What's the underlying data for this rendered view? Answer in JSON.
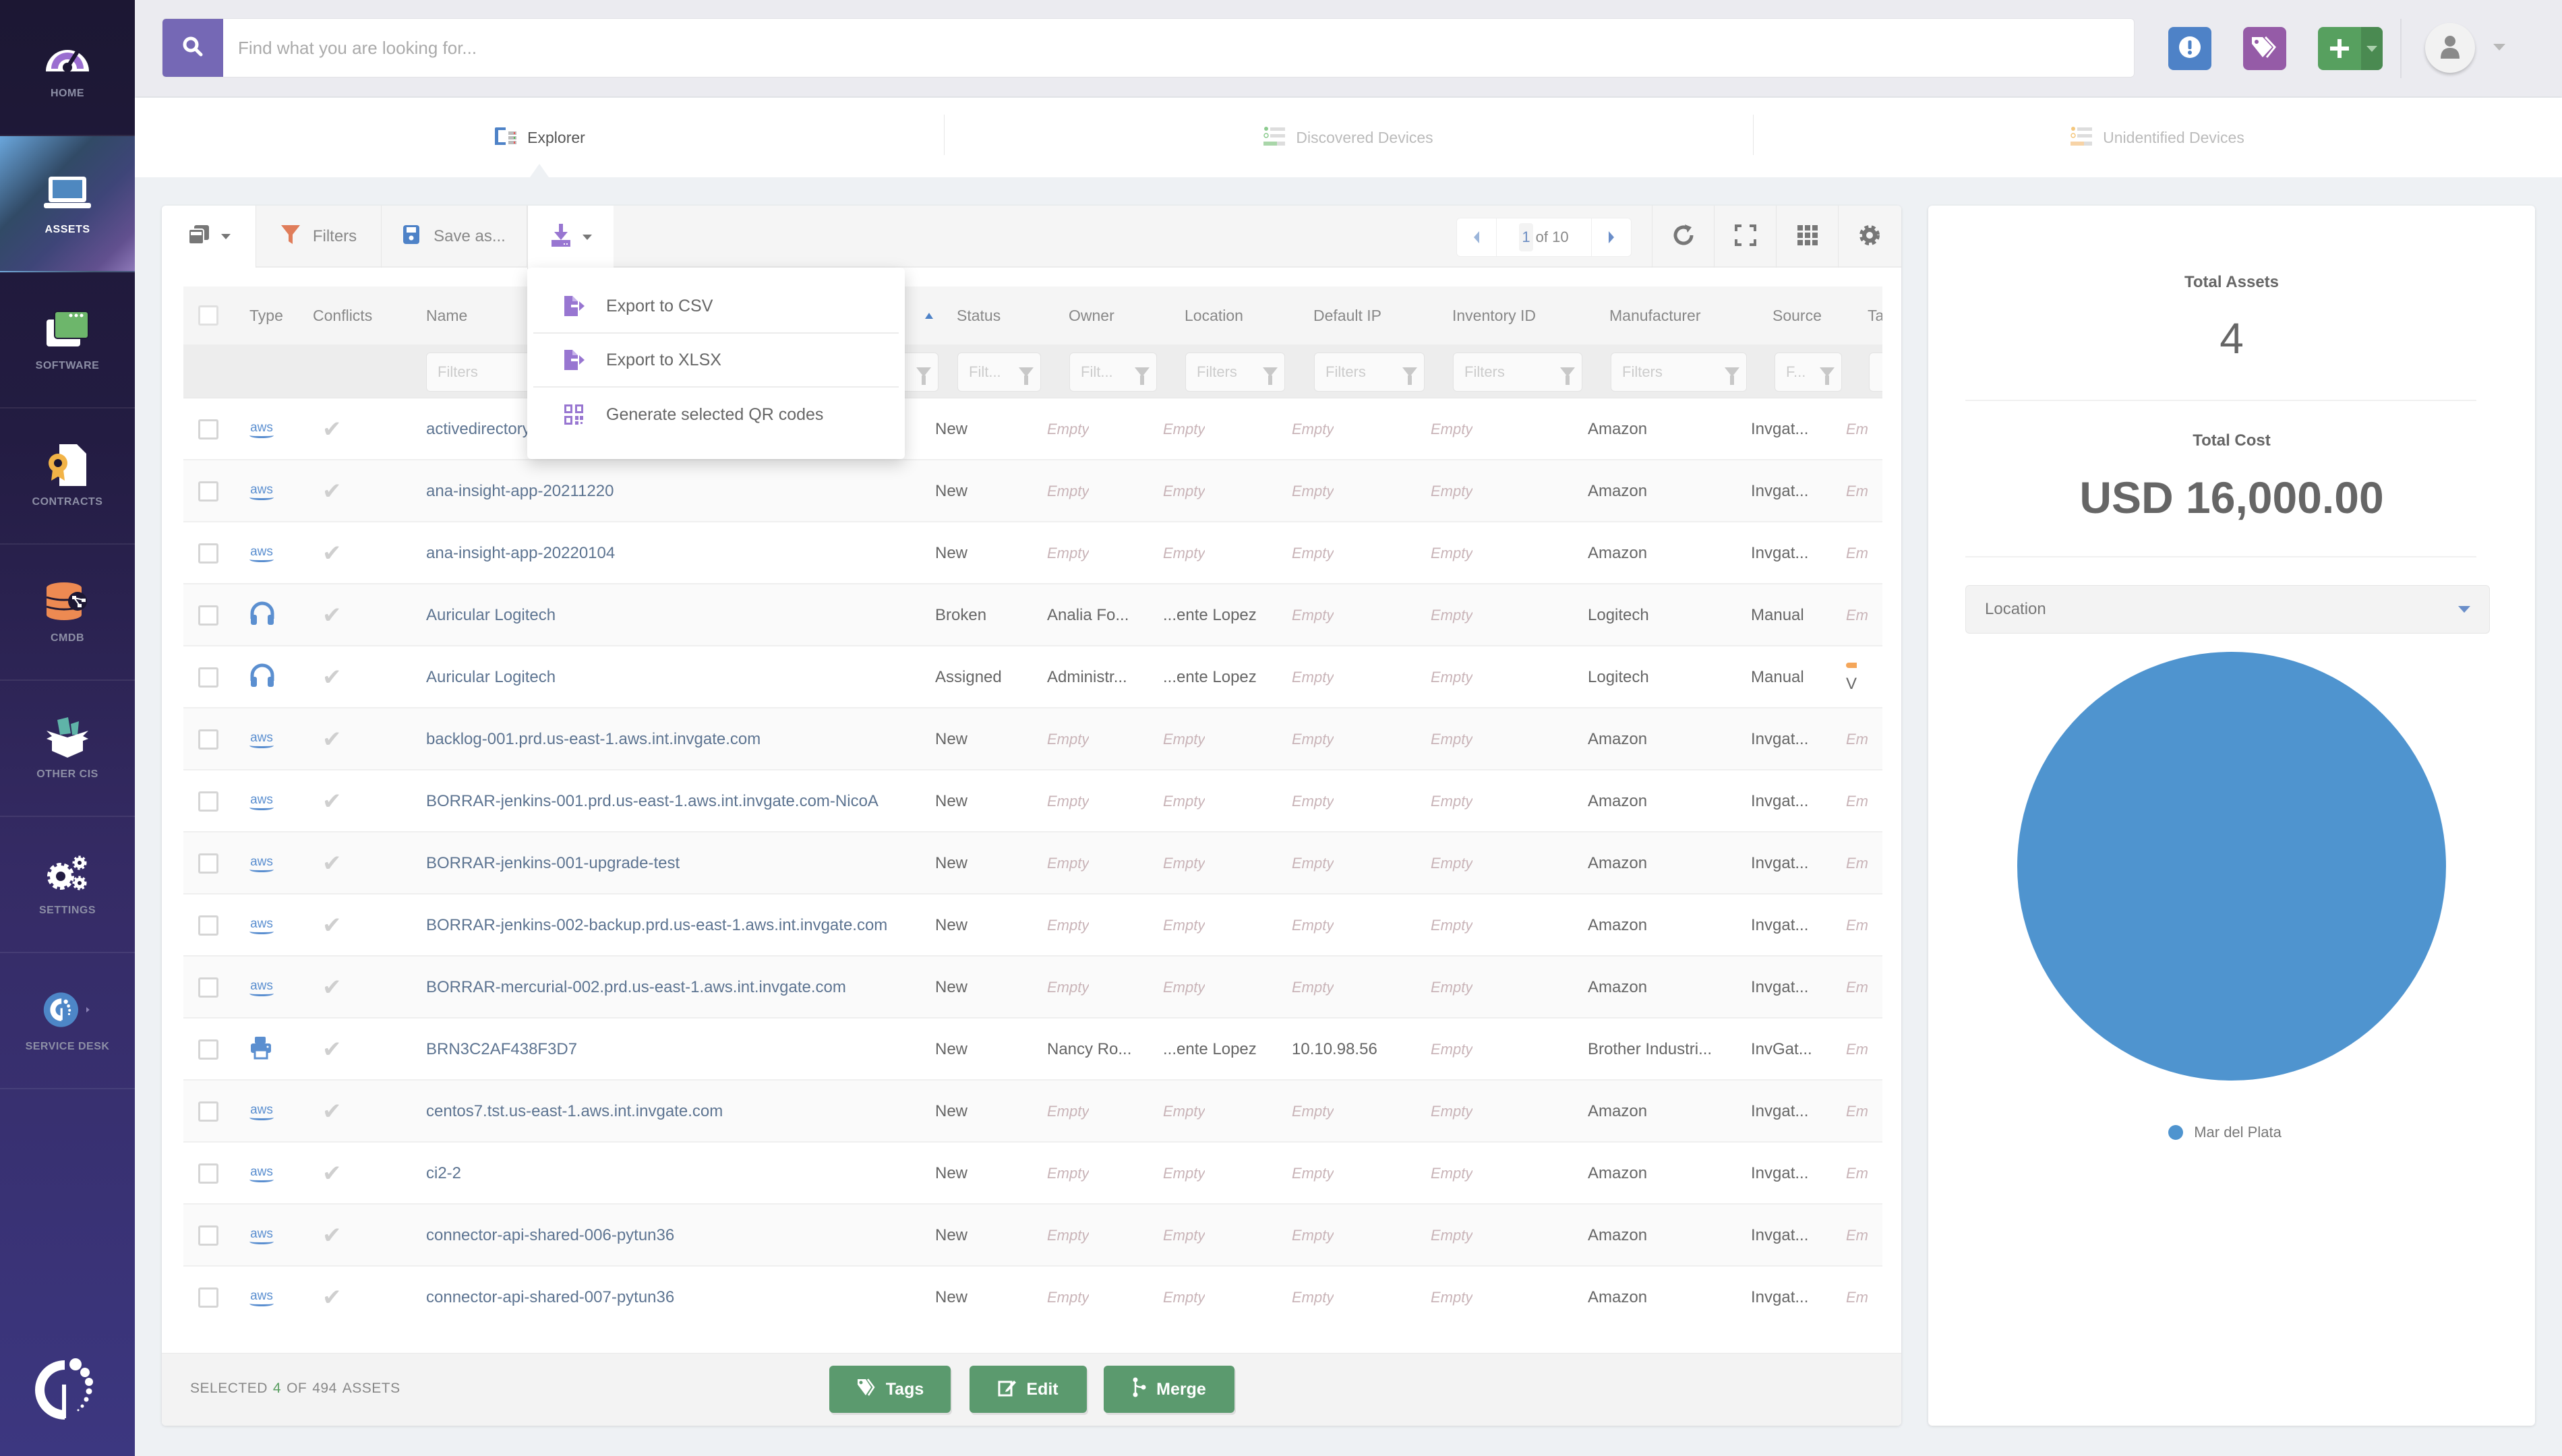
{
  "sidebar": {
    "items": [
      {
        "label": "HOME",
        "icon": "speedometer-icon"
      },
      {
        "label": "ASSETS",
        "icon": "laptop-icon",
        "active": true
      },
      {
        "label": "SOFTWARE",
        "icon": "software-window-icon"
      },
      {
        "label": "CONTRACTS",
        "icon": "contract-icon"
      },
      {
        "label": "CMDB",
        "icon": "database-icon"
      },
      {
        "label": "OTHER CIs",
        "icon": "box-icon"
      },
      {
        "label": "SETTINGS",
        "icon": "gears-icon"
      },
      {
        "label": "SERVICE DESK",
        "icon": "service-desk-icon"
      }
    ]
  },
  "search": {
    "placeholder": "Find what you are looking for..."
  },
  "tabs": [
    {
      "label": "Explorer",
      "active": true
    },
    {
      "label": "Discovered Devices"
    },
    {
      "label": "Unidentified Devices"
    }
  ],
  "toolbar": {
    "filters_label": "Filters",
    "save_label": "Save as...",
    "pager": {
      "current": "1",
      "total_text": "of 10"
    }
  },
  "export_menu": [
    {
      "label": "Export to CSV",
      "icon": "file-export-icon"
    },
    {
      "label": "Export to XLSX",
      "icon": "file-export-icon"
    },
    {
      "label": "Generate selected QR codes",
      "icon": "qr-code-icon"
    }
  ],
  "table": {
    "columns": [
      "Type",
      "Conflicts",
      "Name",
      "Status",
      "Owner",
      "Location",
      "Default IP",
      "Inventory ID",
      "Manufacturer",
      "Source",
      "Tag"
    ],
    "filter_placeholders": {
      "name": "Filters",
      "status": "Filt...",
      "owner": "Filt...",
      "location": "Filters",
      "ip": "Filters",
      "inventory": "Filters",
      "manufacturer": "Filters",
      "source": "F..."
    },
    "rows": [
      {
        "type": "aws",
        "name": "activedirectory",
        "status": "New",
        "owner": "Empty",
        "location": "Empty",
        "ip": "Empty",
        "inventory": "Empty",
        "manufacturer": "Amazon",
        "source": "Invgat...",
        "tag": "Em"
      },
      {
        "type": "aws",
        "name": "ana-insight-app-20211220",
        "status": "New",
        "owner": "Empty",
        "location": "Empty",
        "ip": "Empty",
        "inventory": "Empty",
        "manufacturer": "Amazon",
        "source": "Invgat...",
        "tag": "Em"
      },
      {
        "type": "aws",
        "name": "ana-insight-app-20220104",
        "status": "New",
        "owner": "Empty",
        "location": "Empty",
        "ip": "Empty",
        "inventory": "Empty",
        "manufacturer": "Amazon",
        "source": "Invgat...",
        "tag": "Em"
      },
      {
        "type": "headphones",
        "name": "Auricular Logitech",
        "status": "Broken",
        "owner": "Analia Fo...",
        "location": "...ente Lopez",
        "ip": "Empty",
        "inventory": "Empty",
        "manufacturer": "Logitech",
        "source": "Manual",
        "tag": "Em"
      },
      {
        "type": "headphones",
        "name": "Auricular Logitech",
        "status": "Assigned",
        "owner": "Administr...",
        "location": "...ente Lopez",
        "ip": "Empty",
        "inventory": "Empty",
        "manufacturer": "Logitech",
        "source": "Manual",
        "tag": "V",
        "tag_color": "#f4a65a"
      },
      {
        "type": "aws",
        "name": "backlog-001.prd.us-east-1.aws.int.invgate.com",
        "status": "New",
        "owner": "Empty",
        "location": "Empty",
        "ip": "Empty",
        "inventory": "Empty",
        "manufacturer": "Amazon",
        "source": "Invgat...",
        "tag": "Em"
      },
      {
        "type": "aws",
        "name": "BORRAR-jenkins-001.prd.us-east-1.aws.int.invgate.com-NicoA",
        "status": "New",
        "owner": "Empty",
        "location": "Empty",
        "ip": "Empty",
        "inventory": "Empty",
        "manufacturer": "Amazon",
        "source": "Invgat...",
        "tag": "Em"
      },
      {
        "type": "aws",
        "name": "BORRAR-jenkins-001-upgrade-test",
        "status": "New",
        "owner": "Empty",
        "location": "Empty",
        "ip": "Empty",
        "inventory": "Empty",
        "manufacturer": "Amazon",
        "source": "Invgat...",
        "tag": "Em"
      },
      {
        "type": "aws",
        "name": "BORRAR-jenkins-002-backup.prd.us-east-1.aws.int.invgate.com",
        "status": "New",
        "owner": "Empty",
        "location": "Empty",
        "ip": "Empty",
        "inventory": "Empty",
        "manufacturer": "Amazon",
        "source": "Invgat...",
        "tag": "Em"
      },
      {
        "type": "aws",
        "name": "BORRAR-mercurial-002.prd.us-east-1.aws.int.invgate.com",
        "status": "New",
        "owner": "Empty",
        "location": "Empty",
        "ip": "Empty",
        "inventory": "Empty",
        "manufacturer": "Amazon",
        "source": "Invgat...",
        "tag": "Em"
      },
      {
        "type": "printer",
        "name": "BRN3C2AF438F3D7",
        "status": "New",
        "owner": "Nancy Ro...",
        "location": "...ente Lopez",
        "ip": "10.10.98.56",
        "inventory": "Empty",
        "manufacturer": "Brother Industri...",
        "source": "InvGat...",
        "tag": "Em"
      },
      {
        "type": "aws",
        "name": "centos7.tst.us-east-1.aws.int.invgate.com",
        "status": "New",
        "owner": "Empty",
        "location": "Empty",
        "ip": "Empty",
        "inventory": "Empty",
        "manufacturer": "Amazon",
        "source": "Invgat...",
        "tag": "Em"
      },
      {
        "type": "aws",
        "name": "ci2-2",
        "status": "New",
        "owner": "Empty",
        "location": "Empty",
        "ip": "Empty",
        "inventory": "Empty",
        "manufacturer": "Amazon",
        "source": "Invgat...",
        "tag": "Em"
      },
      {
        "type": "aws",
        "name": "connector-api-shared-006-pytun36",
        "status": "New",
        "owner": "Empty",
        "location": "Empty",
        "ip": "Empty",
        "inventory": "Empty",
        "manufacturer": "Amazon",
        "source": "Invgat...",
        "tag": "Em"
      },
      {
        "type": "aws",
        "name": "connector-api-shared-007-pytun36",
        "status": "New",
        "owner": "Empty",
        "location": "Empty",
        "ip": "Empty",
        "inventory": "Empty",
        "manufacturer": "Amazon",
        "source": "Invgat...",
        "tag": "Em"
      }
    ]
  },
  "footer": {
    "selected_prefix": "SELECTED",
    "selected_count": "4",
    "of_label": "OF",
    "total_count": "494",
    "suffix": "ASSETS",
    "buttons": {
      "tags": "Tags",
      "edit": "Edit",
      "merge": "Merge"
    }
  },
  "summary": {
    "total_assets_label": "Total Assets",
    "total_assets_value": "4",
    "total_cost_label": "Total Cost",
    "total_cost_value": "USD 16,000.00",
    "group_by": "Location"
  },
  "chart_data": {
    "type": "pie",
    "title": "",
    "categories": [
      "Mar del Plata"
    ],
    "values": [
      4
    ],
    "colors": [
      "#4f94cf"
    ],
    "legend": "bottom"
  },
  "colors": {
    "accent": "#7568b5",
    "sidebar_bg": "#1c1733",
    "link": "#5d7491",
    "action_green": "#5b9a6e",
    "empty_text": "#c9b4b8"
  }
}
